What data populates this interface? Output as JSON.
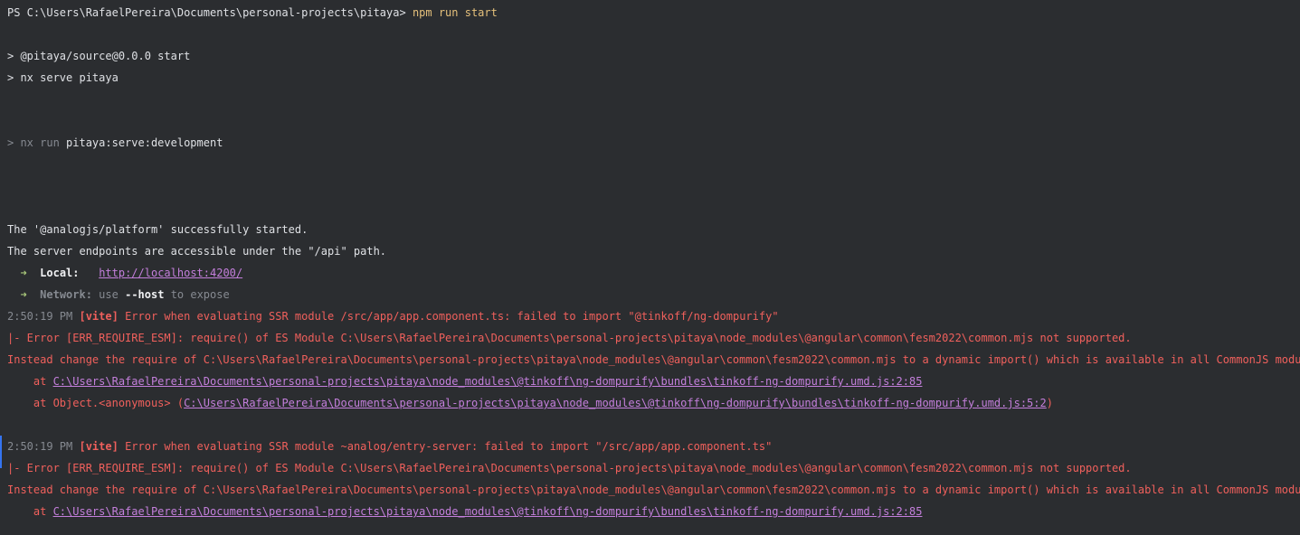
{
  "prompt": {
    "ps_prefix": "PS C:\\Users\\RafaelPereira\\Documents\\personal-projects\\pitaya> ",
    "command": "npm run start"
  },
  "script_lines": {
    "source_start": "> @pitaya/source@0.0.0 start",
    "nx_serve": "> nx serve pitaya"
  },
  "nx_run": {
    "prefix": "> nx run ",
    "target": "pitaya:serve:development"
  },
  "startup": {
    "started": "The '@analogjs/platform' successfully started.",
    "endpoints": "The server endpoints are accessible under the \"/api\" path.",
    "local_arrow": "➜",
    "local_label": "Local:",
    "local_url": "http://localhost:4200/",
    "network_arrow": "➜",
    "network_label": "Network:",
    "network_use": "use",
    "network_flag": "--host",
    "network_rest": "to expose"
  },
  "error1": {
    "time": "2:50:19 PM",
    "tag": "[vite]",
    "message": "Error when evaluating SSR module /src/app/app.component.ts: failed to import \"@tinkoff/ng-dompurify\"",
    "require_esm": "|- Error [ERR_REQUIRE_ESM]: require() of ES Module C:\\Users\\RafaelPereira\\Documents\\personal-projects\\pitaya\\node_modules\\@angular\\common\\fesm2022\\common.mjs not supported.",
    "instead": "Instead change the require of C:\\Users\\RafaelPereira\\Documents\\personal-projects\\pitaya\\node_modules\\@angular\\common\\fesm2022\\common.mjs to a dynamic import() which is available in all CommonJS modules.",
    "at1_prefix": "    at ",
    "at1_path": "C:\\Users\\RafaelPereira\\Documents\\personal-projects\\pitaya\\node_modules\\@tinkoff\\ng-dompurify\\bundles\\tinkoff-ng-dompurify.umd.js:2:85",
    "at2_prefix": "    at Object.<anonymous> (",
    "at2_path": "C:\\Users\\RafaelPereira\\Documents\\personal-projects\\pitaya\\node_modules\\@tinkoff\\ng-dompurify\\bundles\\tinkoff-ng-dompurify.umd.js:5:2",
    "at2_suffix": ")"
  },
  "error2": {
    "time": "2:50:19 PM",
    "tag": "[vite]",
    "message": "Error when evaluating SSR module ~analog/entry-server: failed to import \"/src/app/app.component.ts\"",
    "require_esm": "|- Error [ERR_REQUIRE_ESM]: require() of ES Module C:\\Users\\RafaelPereira\\Documents\\personal-projects\\pitaya\\node_modules\\@angular\\common\\fesm2022\\common.mjs not supported.",
    "instead": "Instead change the require of C:\\Users\\RafaelPereira\\Documents\\personal-projects\\pitaya\\node_modules\\@angular\\common\\fesm2022\\common.mjs to a dynamic import() which is available in all CommonJS modules.",
    "at1_prefix": "    at ",
    "at1_path": "C:\\Users\\RafaelPereira\\Documents\\personal-projects\\pitaya\\node_modules\\@tinkoff\\ng-dompurify\\bundles\\tinkoff-ng-dompurify.umd.js:2:85"
  },
  "colors": {
    "background": "#2b2d30",
    "text": "#dfe1e5",
    "command": "#e5c07b",
    "muted": "#868a91",
    "error": "#f0605c",
    "link": "#c47fdc",
    "arrow": "#a8c77a",
    "gutter_marker": "#3574f0"
  }
}
